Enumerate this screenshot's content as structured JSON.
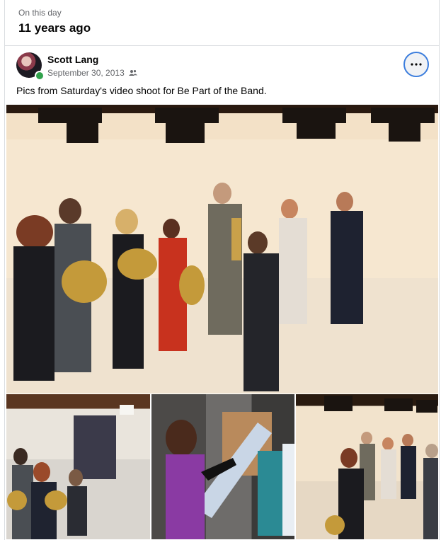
{
  "memory": {
    "eyebrow": "On this day",
    "years_ago": "11 years ago"
  },
  "post": {
    "author": "Scott Lang",
    "date": "September 30, 2013",
    "audience_icon": "friends-icon",
    "more_icon": "more-horizontal-icon",
    "caption": "Pics from Saturday's video shoot for Be Part of the Band.",
    "photo_count": 4
  },
  "colors": {
    "online": "#31a24c",
    "focus_ring": "#3b7ddd",
    "secondary_text": "#65676b"
  }
}
